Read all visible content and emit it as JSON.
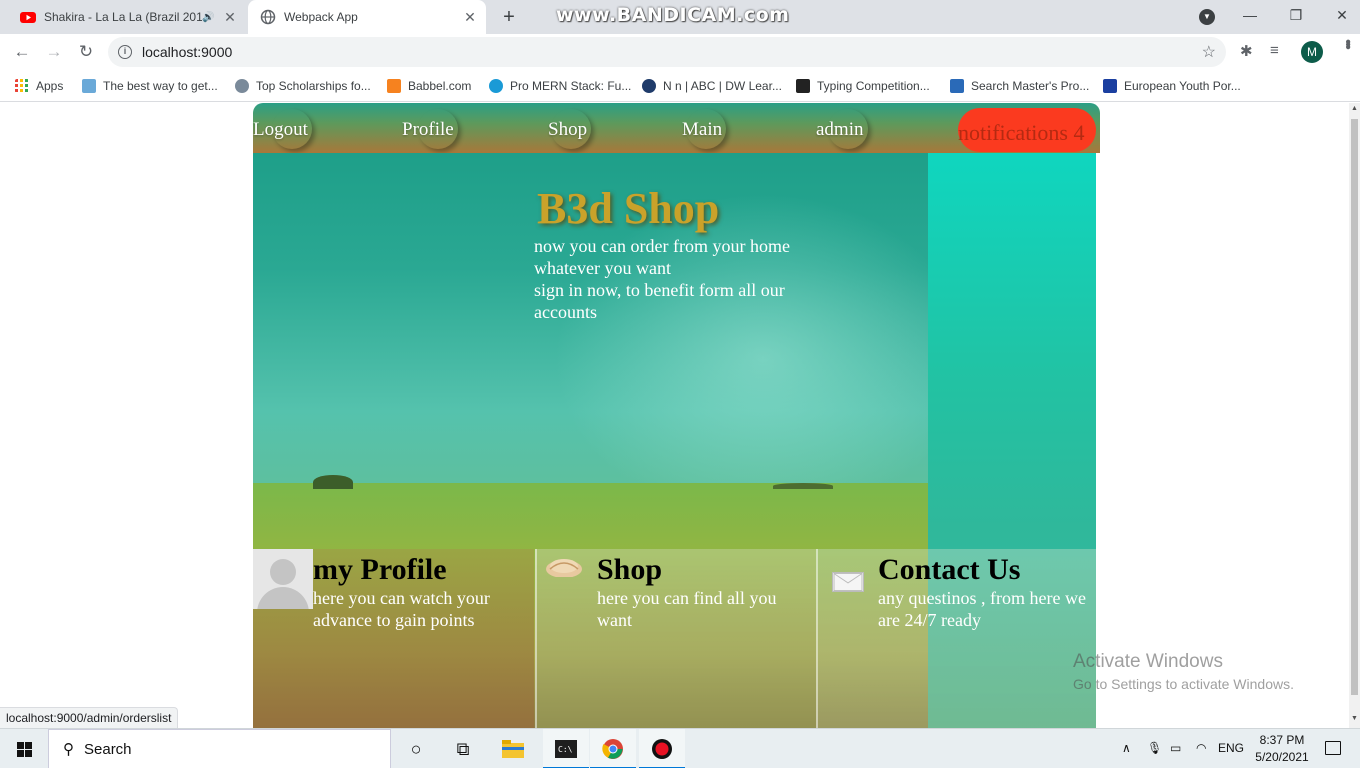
{
  "browser": {
    "tabs": [
      {
        "title": "Shakira - La La La (Brazil 2014",
        "close": "✕",
        "audio": "🔊"
      },
      {
        "title": "Webpack App",
        "close": "✕"
      }
    ],
    "new_tab": "+",
    "recorder_watermark": "www.BANDICAM.com",
    "window_controls": {
      "minimize": "—",
      "maximize": "❐",
      "close": "✕"
    },
    "nav": {
      "back": "←",
      "forward": "→",
      "reload": "↻"
    },
    "url": "localhost:9000",
    "profile_initial": "M",
    "bookmarks": [
      {
        "label": "Apps",
        "color": "#e94235"
      },
      {
        "label": "The best way to get...",
        "color": "#6aa9d8"
      },
      {
        "label": "Top Scholarships fo...",
        "color": "#7a8a9a"
      },
      {
        "label": "Babbel.com",
        "color": "#f6821f"
      },
      {
        "label": "Pro MERN Stack: Fu...",
        "color": "#1a9ad6"
      },
      {
        "label": "N n | ABC | DW Lear...",
        "color": "#1f3b6a"
      },
      {
        "label": "Typing Competition...",
        "color": "#222222"
      },
      {
        "label": "Search Master's Pro...",
        "color": "#2a6ab8"
      },
      {
        "label": "European Youth Por...",
        "color": "#1b3fa0"
      }
    ],
    "status_url": "localhost:9000/admin/orderslist"
  },
  "nav": {
    "links": [
      "Logout",
      "Profile",
      "Shop",
      "Main",
      "admin"
    ],
    "notifications": "notifications 4"
  },
  "hero": {
    "title": "B3d Shop",
    "subtitle_lines": [
      "now you can order from your home",
      "whatever you want",
      "sign in now, to benefit form all our",
      "accounts"
    ]
  },
  "cards": [
    {
      "title": "my Profile",
      "desc": "here you can watch your advance to gain points",
      "icon": "avatar-icon"
    },
    {
      "title": "Shop",
      "desc": "here you can find all you want",
      "icon": "shop-icon"
    },
    {
      "title": "Contact Us",
      "desc": "any questinos , from here we are 24/7 ready",
      "icon": "mail-icon"
    }
  ],
  "windows": {
    "activate_title": "Activate Windows",
    "activate_sub": "Go to Settings to activate Windows.",
    "search_placeholder": "Search",
    "language": "ENG",
    "time": "8:37 PM",
    "date": "5/20/2021"
  }
}
